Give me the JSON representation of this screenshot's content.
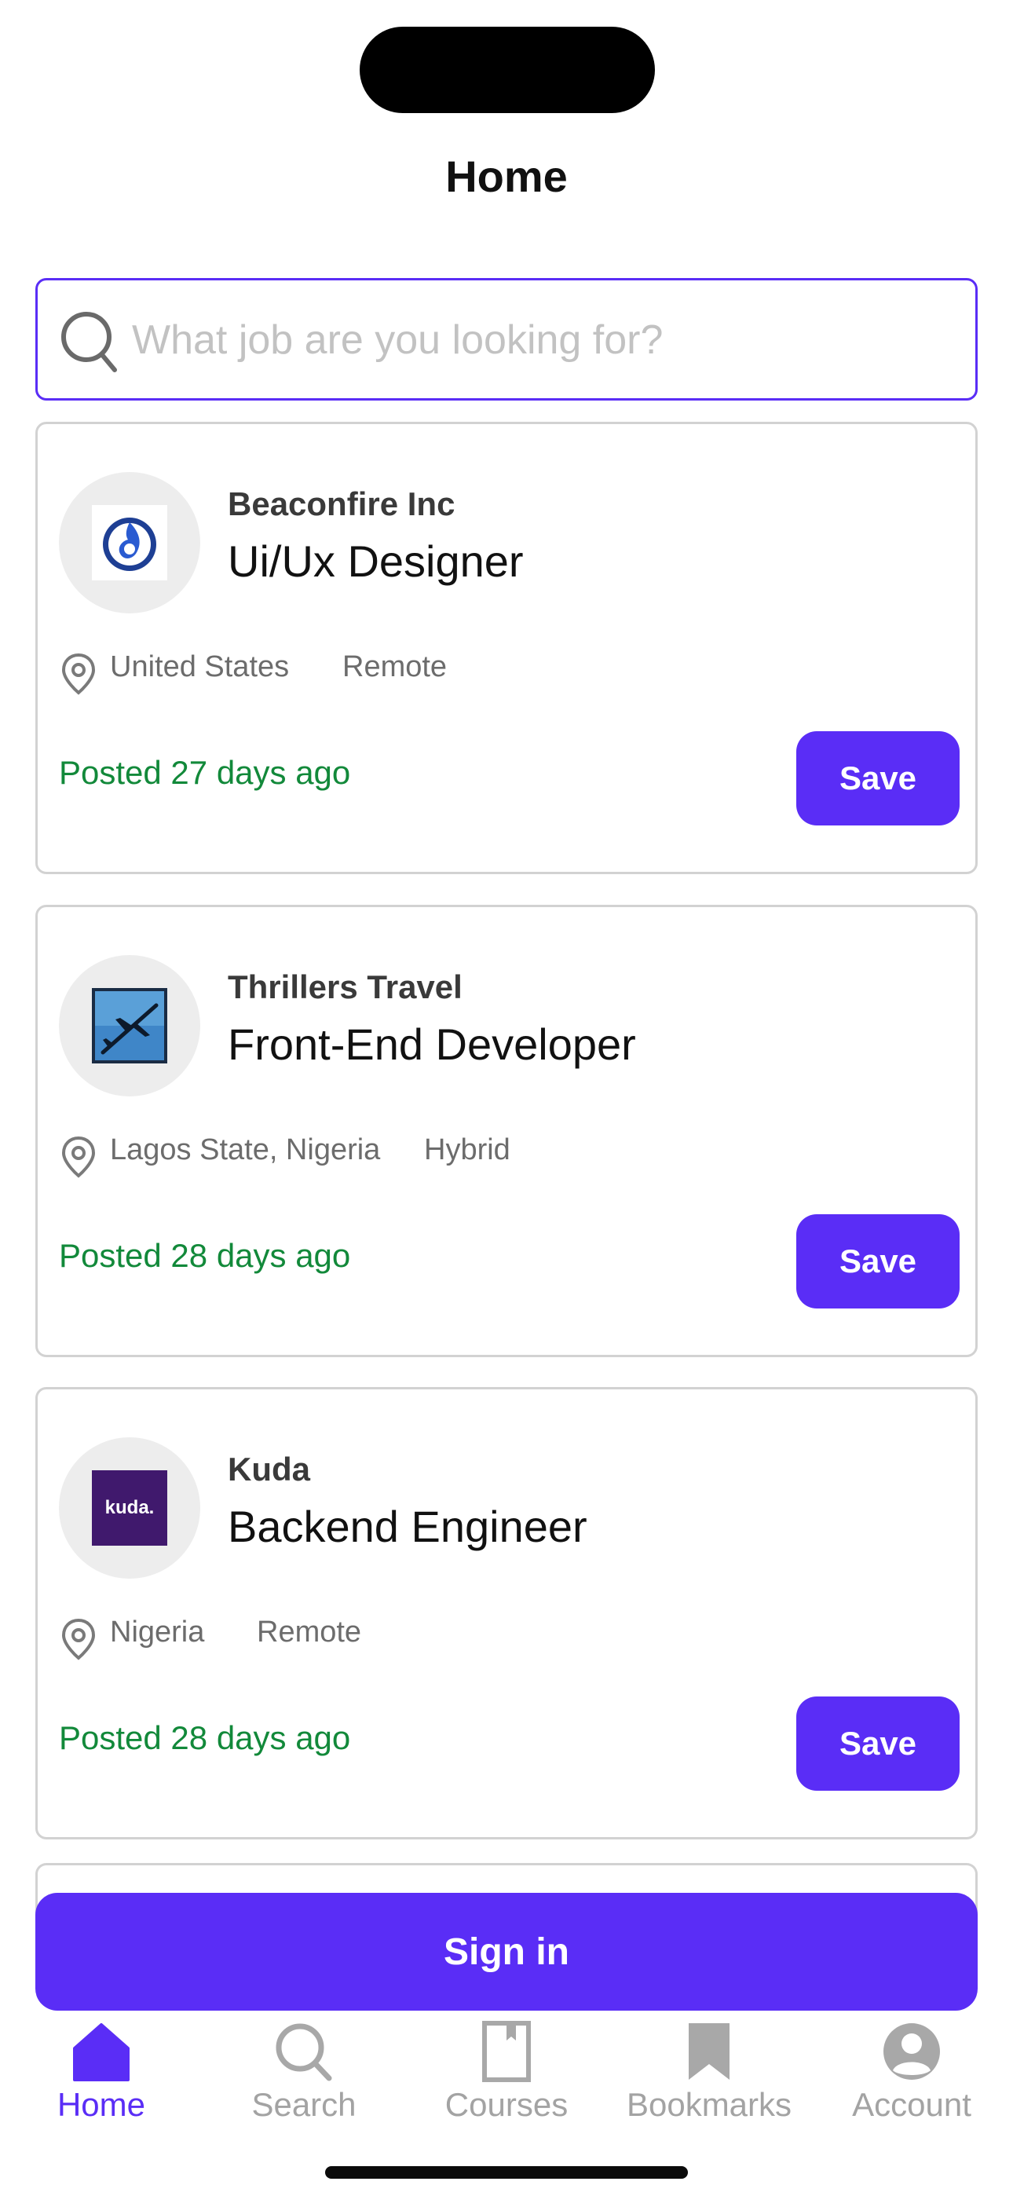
{
  "header": {
    "title": "Home"
  },
  "search": {
    "placeholder": "What job are you looking for?",
    "value": ""
  },
  "jobs": [
    {
      "company": "Beaconfire Inc",
      "title": "Ui/Ux Designer",
      "location": "United States",
      "work_type": "Remote",
      "posted": "Posted 27 days ago",
      "save_label": "Save",
      "logo_icon": "beaconfire-flame-logo"
    },
    {
      "company": "Thrillers Travel",
      "title": "Front-End Developer",
      "location": "Lagos State, Nigeria",
      "work_type": "Hybrid",
      "posted": "Posted 28 days ago",
      "save_label": "Save",
      "logo_icon": "airplane-logo"
    },
    {
      "company": "Kuda",
      "title": "Backend Engineer",
      "location": "Nigeria",
      "work_type": "Remote",
      "posted": "Posted 28 days ago",
      "save_label": "Save",
      "logo_icon": "kuda-logo",
      "logo_text": "kuda."
    }
  ],
  "signin": {
    "label": "Sign in"
  },
  "tabbar": {
    "items": [
      {
        "label": "Home",
        "icon": "home-icon",
        "active": true
      },
      {
        "label": "Search",
        "icon": "search-icon",
        "active": false
      },
      {
        "label": "Courses",
        "icon": "book-icon",
        "active": false
      },
      {
        "label": "Bookmarks",
        "icon": "bookmark-icon",
        "active": false
      },
      {
        "label": "Account",
        "icon": "account-icon",
        "active": false
      }
    ]
  },
  "colors": {
    "accent": "#5a2df6",
    "posted_green": "#12893a",
    "muted_text": "#6c6c6c",
    "inactive_tab": "#a3a3a3"
  }
}
